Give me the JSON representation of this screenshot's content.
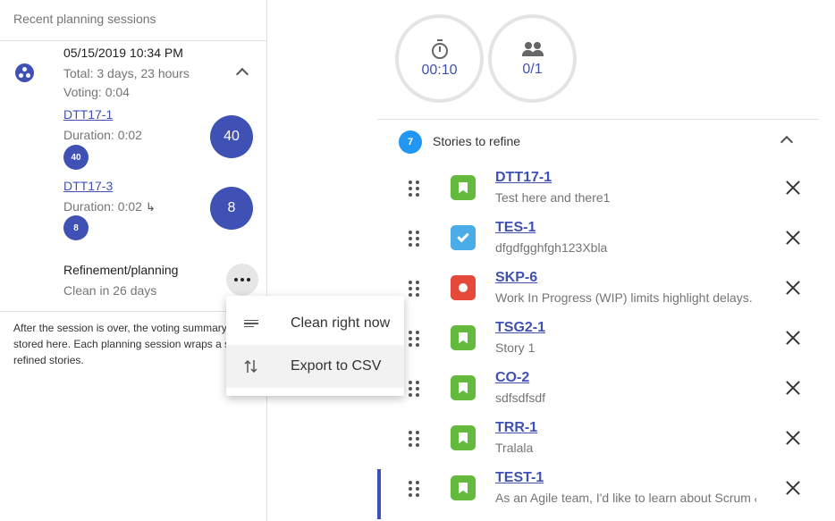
{
  "sidebar": {
    "header": "Recent planning sessions",
    "session": {
      "date": "05/15/2019 10:34 PM",
      "total": "Total: 3 days, 23 hours",
      "voting": "Voting: 0:04",
      "stories": [
        {
          "key": "DTT17-1",
          "duration": "Duration: 0:02",
          "estimate": "40"
        },
        {
          "key": "DTT17-3",
          "duration": "Duration: 0:02",
          "estimate": "8"
        }
      ]
    },
    "refinement": {
      "title": "Refinement/planning",
      "clean": "Clean in 26 days"
    },
    "info": [
      "After the session is over, the voting summary",
      "stored here. Each planning session wraps a s",
      "refined stories."
    ]
  },
  "menu": {
    "items": [
      {
        "label": "Clean right now",
        "icon": "lines-icon"
      },
      {
        "label": "Export to CSV",
        "icon": "sort-arrows-icon"
      }
    ]
  },
  "timer": {
    "value": "00:10",
    "icon": "stopwatch-icon"
  },
  "participants": {
    "value": "0/1",
    "icon": "people-icon"
  },
  "stories": {
    "count": "7",
    "title": "Stories to refine",
    "items": [
      {
        "key": "DTT17-1",
        "desc": "Test here and there1",
        "type": "story"
      },
      {
        "key": "TES-1",
        "desc": "dfgdfgghfgh123Xbla",
        "type": "task"
      },
      {
        "key": "SKP-6",
        "desc": "Work In Progress (WIP) limits highlight delays.",
        "type": "bug"
      },
      {
        "key": "TSG2-1",
        "desc": "Story 1",
        "type": "story"
      },
      {
        "key": "CO-2",
        "desc": "sdfsdfsdf",
        "type": "story"
      },
      {
        "key": "TRR-1",
        "desc": "Tralala",
        "type": "story"
      },
      {
        "key": "TEST-1",
        "desc": "As an Agile team, I'd like to learn about Scrum &",
        "type": "story"
      }
    ]
  },
  "colors": {
    "accent": "#3f51b5",
    "count_badge": "#2196f3",
    "story": "#63ba3c",
    "task": "#4bade8",
    "bug": "#e5493a"
  }
}
